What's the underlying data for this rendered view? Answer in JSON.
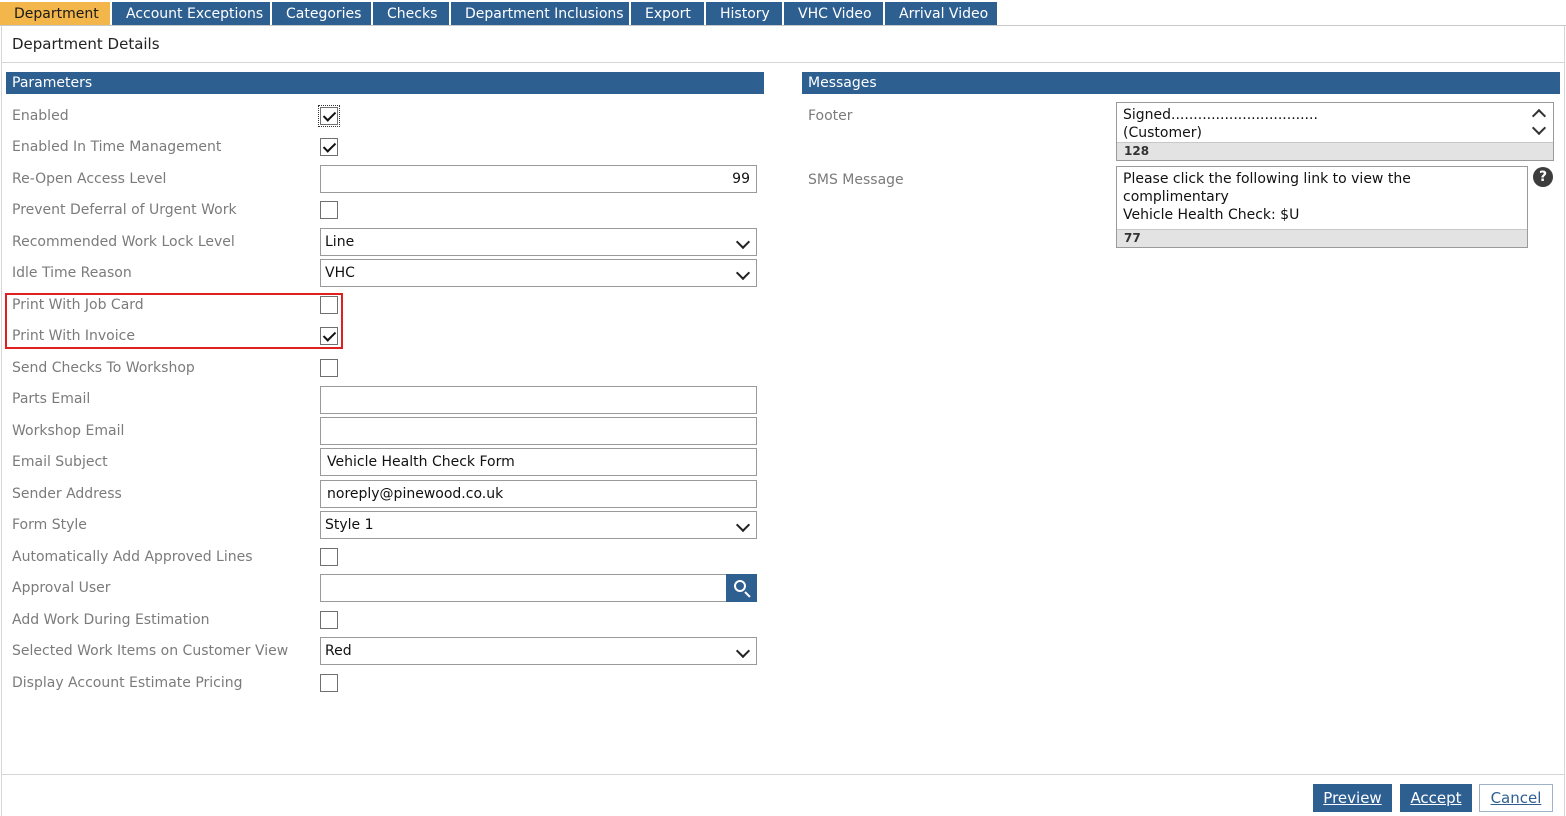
{
  "tabs": [
    "Department",
    "Account Exceptions",
    "Categories",
    "Checks",
    "Department Inclusions",
    "Export",
    "History",
    "VHC Video",
    "Arrival Video"
  ],
  "page_title": "Department Details",
  "parameters": {
    "header": "Parameters",
    "enabled": {
      "label": "Enabled",
      "checked": true
    },
    "enabled_time_mgmt": {
      "label": "Enabled In Time Management",
      "checked": true
    },
    "reopen_access_level": {
      "label": "Re-Open Access Level",
      "value": "99"
    },
    "prevent_deferral": {
      "label": "Prevent Deferral of Urgent Work",
      "checked": false
    },
    "recommended_lock_level": {
      "label": "Recommended Work Lock Level",
      "value": "Line"
    },
    "idle_time_reason": {
      "label": "Idle Time Reason",
      "value": "VHC"
    },
    "print_job_card": {
      "label": "Print With Job Card",
      "checked": false
    },
    "print_invoice": {
      "label": "Print With Invoice",
      "checked": true
    },
    "send_checks_workshop": {
      "label": "Send Checks To Workshop",
      "checked": false
    },
    "parts_email": {
      "label": "Parts Email",
      "value": ""
    },
    "workshop_email": {
      "label": "Workshop Email",
      "value": ""
    },
    "email_subject": {
      "label": "Email Subject",
      "value": "Vehicle Health Check Form"
    },
    "sender_address": {
      "label": "Sender Address",
      "value": "noreply@pinewood.co.uk"
    },
    "form_style": {
      "label": "Form Style",
      "value": "Style 1"
    },
    "auto_add_approved": {
      "label": "Automatically Add Approved Lines",
      "checked": false
    },
    "approval_user": {
      "label": "Approval User",
      "value": ""
    },
    "add_work_estimation": {
      "label": "Add Work During Estimation",
      "checked": false
    },
    "selected_work_items": {
      "label": "Selected Work Items on Customer View",
      "value": "Red"
    },
    "display_account_estimate": {
      "label": "Display Account Estimate Pricing",
      "checked": false
    }
  },
  "messages": {
    "header": "Messages",
    "footer": {
      "label": "Footer",
      "value": "Signed.................................\n(Customer)",
      "count": "128"
    },
    "sms": {
      "label": "SMS Message",
      "value": "Please click the following link to view the complimentary\nVehicle Health Check: $U",
      "count": "77",
      "help": "?"
    }
  },
  "buttons": {
    "preview": {
      "label": "Preview"
    },
    "accept": {
      "label": "Accept"
    },
    "cancel": {
      "label": "Cancel"
    }
  },
  "colors": {
    "accent": "#2e5f91",
    "active_tab": "#f2b64b",
    "highlight": "#e01f1f"
  }
}
